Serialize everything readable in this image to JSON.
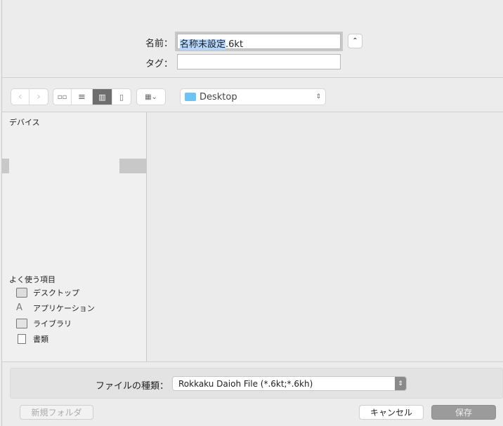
{
  "form": {
    "name_label": "名前：",
    "name_selected": "名称未設定",
    "name_ext": ".6kt",
    "tag_label": "タグ：",
    "tag_value": ""
  },
  "toolbar": {
    "location": "Desktop"
  },
  "sidebar": {
    "devices_header": "デバイス",
    "favorites_header": "よく使う項目",
    "favorites": [
      {
        "label": "デスクトップ",
        "icon": "desktop-icon"
      },
      {
        "label": "アプリケーション",
        "icon": "applications-icon"
      },
      {
        "label": "ライブラリ",
        "icon": "folder-icon"
      },
      {
        "label": "書類",
        "icon": "documents-icon"
      }
    ]
  },
  "filetype": {
    "label": "ファイルの種類：",
    "value": "Rokkaku Daioh File (*.6kt;*.6kh)"
  },
  "buttons": {
    "new_folder": "新規フォルダ",
    "cancel": "キャンセル",
    "save": "保存"
  }
}
